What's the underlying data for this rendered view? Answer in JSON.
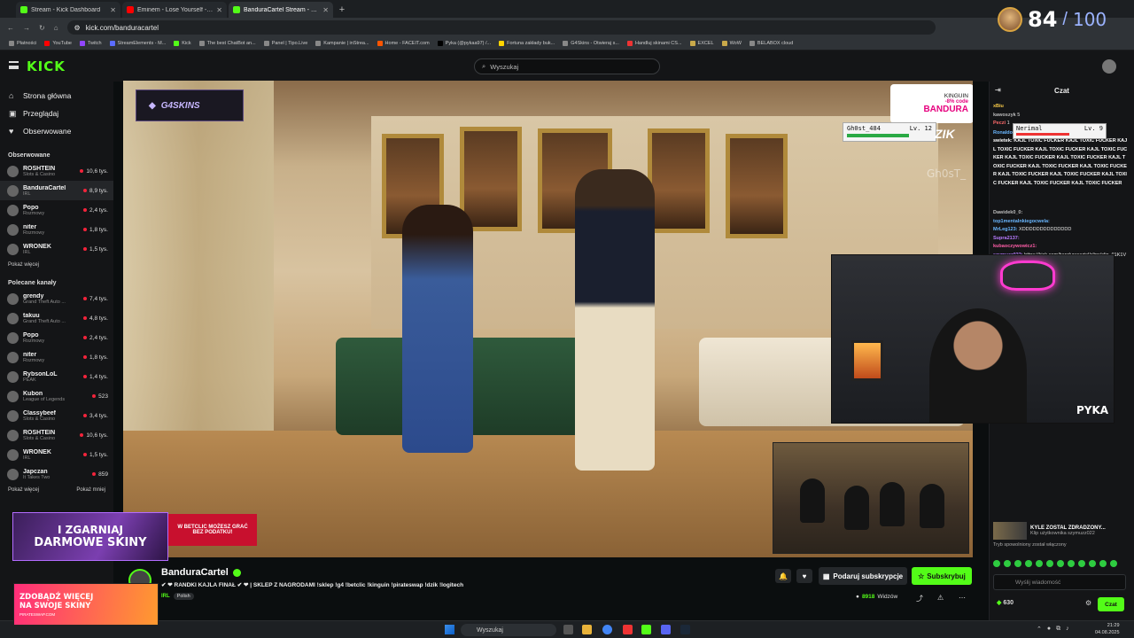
{
  "browser": {
    "tabs": [
      {
        "title": "Stream - Kick Dashboard",
        "color": "#53fc18",
        "active": false
      },
      {
        "title": "Eminem - Lose Yourself - YouTube",
        "color": "#ff0000",
        "active": false
      },
      {
        "title": "BanduraCartel Stream - Watch Live",
        "color": "#53fc18",
        "active": true
      }
    ],
    "new_tab": "+",
    "url": "kick.com/banduracartel",
    "bookmarks": [
      "Płatności",
      "YouTube",
      "Twitch",
      "StreamElements - M...",
      "Kick",
      "The best ChatBot an...",
      "Panel | Tipo.Live",
      "Kampanie | inStrea...",
      "Home - FACEIT.com",
      "Pyka (@pykaa97) /...",
      "Fortuna zakłady buk...",
      "G4Skins - Otwieraj s...",
      "Handluj skinami CS...",
      "EXCEL",
      "WoW",
      "BELABOX cloud"
    ]
  },
  "header": {
    "logo": "KICK",
    "search_placeholder": "Wyszukaj"
  },
  "overlay_counter": {
    "current": "84",
    "separator": "/",
    "max": "100"
  },
  "sidebar": {
    "nav": [
      {
        "label": "Strona główna",
        "icon": "home-icon",
        "glyph": "⌂"
      },
      {
        "label": "Przeglądaj",
        "icon": "browse-icon",
        "glyph": "▣"
      },
      {
        "label": "Obserwowane",
        "icon": "heart-icon",
        "glyph": "♥"
      }
    ],
    "followed_header": "Obserwowane",
    "followed": [
      {
        "name": "ROSHTEIN",
        "category": "Slots & Casino",
        "viewers": "10,6 tys.",
        "selected": false
      },
      {
        "name": "BanduraCartel",
        "category": "IRL",
        "viewers": "8,9 tys.",
        "selected": true
      },
      {
        "name": "Popo",
        "category": "Rozmowy",
        "viewers": "2,4 tys.",
        "selected": false
      },
      {
        "name": "niter",
        "category": "Rozmowy",
        "viewers": "1,8 tys.",
        "selected": false
      },
      {
        "name": "WRONEK",
        "category": "IRL",
        "viewers": "1,5 tys.",
        "selected": false
      }
    ],
    "followed_more": "Pokaż więcej",
    "recommended_header": "Polecane kanały",
    "recommended": [
      {
        "name": "grendy",
        "category": "Grand Theft Auto ...",
        "viewers": "7,4 tys."
      },
      {
        "name": "takuu",
        "category": "Grand Theft Auto ...",
        "viewers": "4,8 tys."
      },
      {
        "name": "Popo",
        "category": "Rozmowy",
        "viewers": "2,4 tys."
      },
      {
        "name": "niter",
        "category": "Rozmowy",
        "viewers": "1,8 tys."
      },
      {
        "name": "RybsonLoL",
        "category": "PEAK",
        "viewers": "1,4 tys."
      },
      {
        "name": "Kubon",
        "category": "League of Legends",
        "viewers": "523"
      },
      {
        "name": "Classybeef",
        "category": "Slots & Casino",
        "viewers": "3,4 tys."
      },
      {
        "name": "ROSHTEIN",
        "category": "Slots & Casino",
        "viewers": "10,6 tys."
      },
      {
        "name": "WRONEK",
        "category": "IRL",
        "viewers": "1,5 tys."
      },
      {
        "name": "Japczan",
        "category": "It Takes Two",
        "viewers": "859"
      }
    ],
    "recommended_more": "Pokaż więcej",
    "recommended_less": "Pokaż mniej"
  },
  "ads": {
    "skins_line1": "I ZGARNIAJ",
    "skins_line2": "DARMOWE SKINY",
    "betclic_line1": "W BETCLIC MOŻESZ GRAĆ",
    "betclic_line2": "BEZ PODATKU!",
    "pirate_line1": "ZDOBĄDŹ WIĘCEJ",
    "pirate_line2": "NA SWOJE SKINY",
    "pirate_line3": "PIRATESWAP.COM"
  },
  "video_overlays": {
    "g4skins": "G4SKINS",
    "kinguin_brand": "KINGUIN",
    "kinguin_promo": "-8% code",
    "kinguin_code": "BANDURA",
    "ghost_name": "Gh0st_484",
    "ghost_level": "Lv. 12",
    "zik": "ZIK",
    "ghost_watermark": "Gh0sT_",
    "webcam_label": "PYKA"
  },
  "stream_info": {
    "channel": "BanduraCartel",
    "title": "✔ ❤ RANDKI KAJLA FINAŁ ✔ ❤ | SKLEP Z NAGRODAMI !sklep !g4 !betclic !kinguin !pirateswap !dzik !logitech",
    "category": "IRL",
    "tag": "Polish",
    "gift_label": "Podaruj subskrypcje",
    "subscribe_label": "Subskrybuj",
    "viewers": "8918",
    "viewers_label": "Widzów"
  },
  "chat": {
    "title": "Czat",
    "overlay_user": "Nerimal",
    "overlay_level": "Lv. 9",
    "messages": [
      {
        "user": "xBiu",
        "text": "",
        "color": "#f7c948"
      },
      {
        "user": "kawoszyk",
        "text": "5",
        "color": "#bbbbbb"
      },
      {
        "user": "Peczi",
        "text": "1",
        "color": "#ff6b6b"
      },
      {
        "user": "Ronaldo:",
        "text": "numer miał a nie napiwek",
        "color": "#6ab7ff"
      },
      {
        "user": "swietek:",
        "text": "KAJL TOXIC FUCKER KAJL TOXIC FUCKER KAJL TOXIC FUCKER KAJL TOXIC FUCKER KAJL TOXIC FUCKER KAJL TOXIC FUCKER KAJL TOXIC FUCKER KAJL TOXIC FUCKER KAJL TOXIC FUCKER KAJL TOXIC FUCKER KAJL TOXIC FUCKER KAJL TOXIC FUCKER KAJL TOXIC FUCKER KAJL TOXIC FUCKER KAJL TOXIC FUCKER",
        "color": "#ffffff"
      },
      {
        "user": "Dawidek0_0:",
        "text": "",
        "color": "#bbbbbb"
      },
      {
        "user": "top1mentalnkiegocwela:",
        "text": "",
        "color": "#6ab7ff"
      },
      {
        "user": "MrLeg123:",
        "text": "XDDDDDDDDDDDDDD",
        "color": "#6ab7ff"
      },
      {
        "user": "Supra2137:",
        "text": "",
        "color": "#b77bff"
      },
      {
        "user": "kubaoczywowicz1:",
        "text": "",
        "color": "#ff5ea8"
      },
      {
        "user": "szymuzz022:",
        "text": "https://kick.com/banduracartel/clips/clip_01K1V8VSTYZP8ZKZD9FMZXFNGX",
        "color": "#b77bff"
      }
    ],
    "clip_title": "KYLE ZOSTAL ZDRADZONY...",
    "clip_sub": "Klip użytkownika szymuzz022",
    "slow_mode": "Tryb spowolniony został włączony",
    "input_placeholder": "Wyślij wiadomość",
    "points": "630",
    "send_label": "Czat"
  },
  "taskbar": {
    "search_placeholder": "Wyszukaj",
    "time": "21:29",
    "date": "04.08.2025"
  }
}
